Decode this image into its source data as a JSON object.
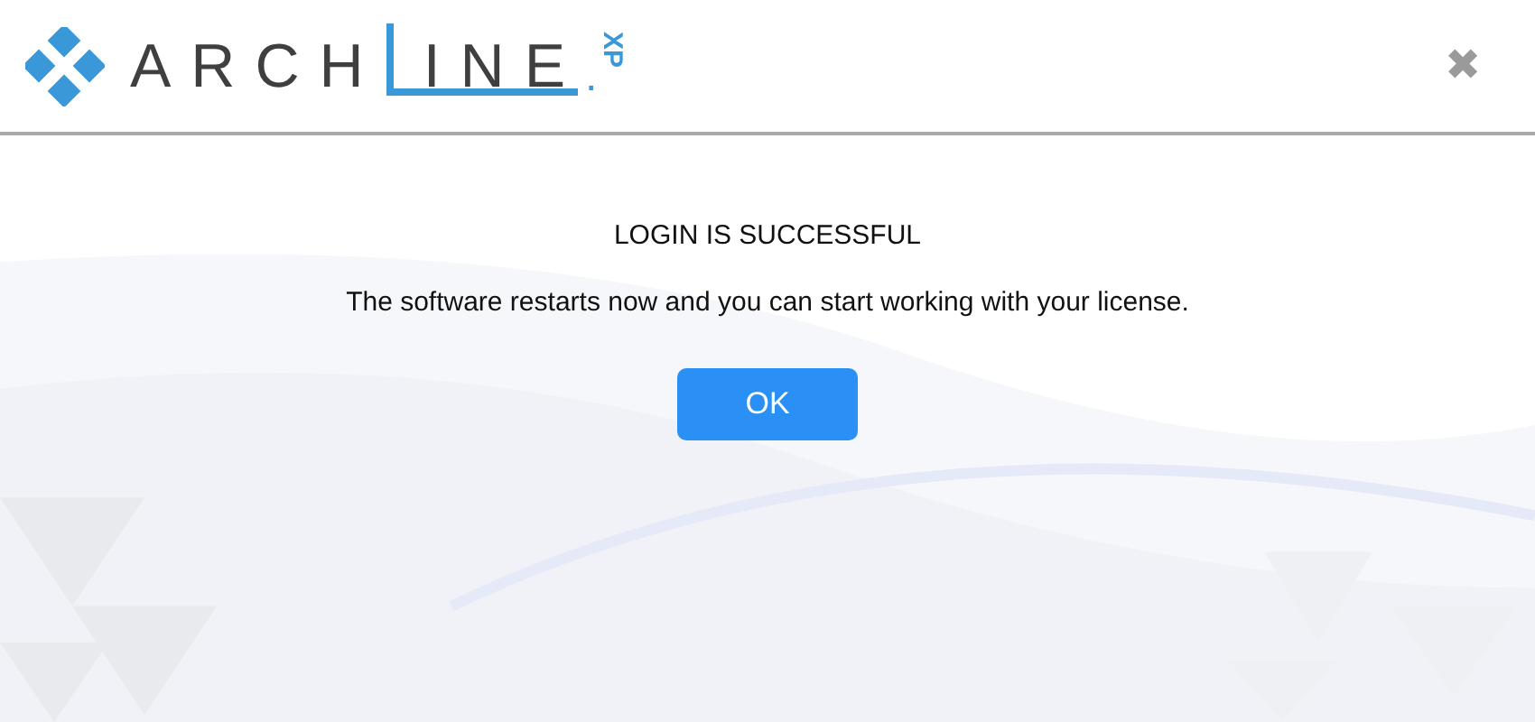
{
  "logo": {
    "word_start": "ARCH",
    "word_end": "INE",
    "dot": ".",
    "suffix": "XP"
  },
  "close": {
    "symbol": "✖"
  },
  "title": "LOGIN IS SUCCESSFUL",
  "message": "The software restarts now and you can start working with your license.",
  "buttons": [
    {
      "label": "OK",
      "kind": "primary"
    }
  ]
}
